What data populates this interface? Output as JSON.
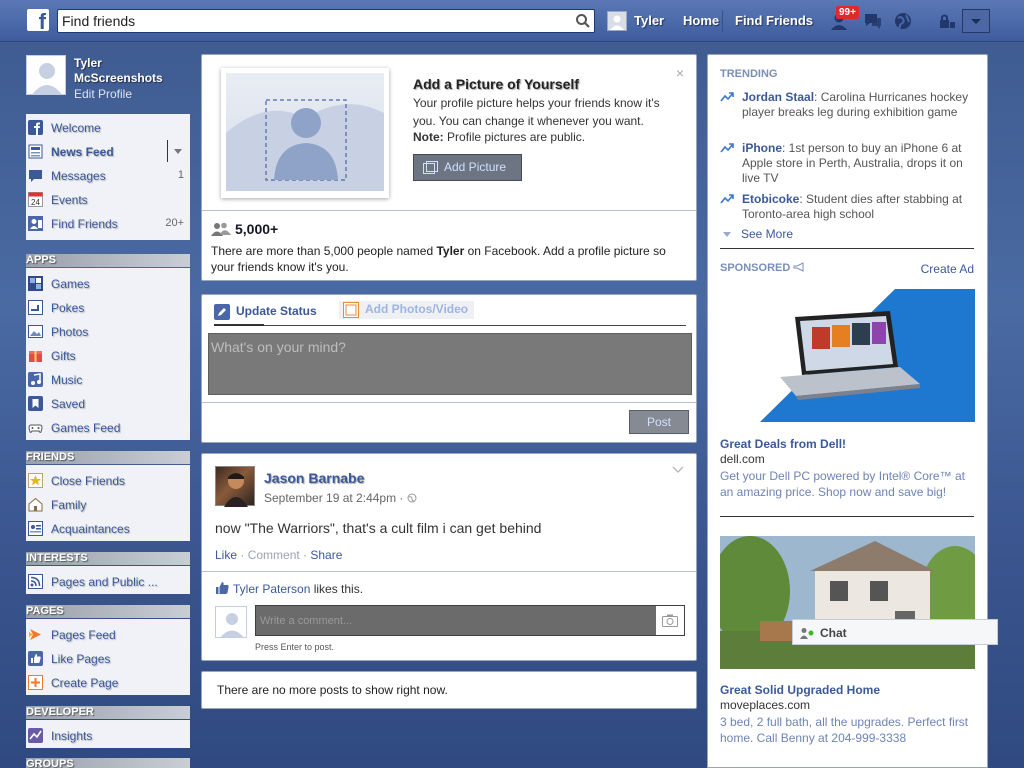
{
  "topbar": {
    "logo": "f",
    "search_placeholder": "Find friends",
    "user_name": "Tyler",
    "home_label": "Home",
    "find_friends_label": "Find Friends",
    "notification_badge": "99+"
  },
  "profile": {
    "name": "Tyler McScreenshots",
    "edit_label": "Edit Profile"
  },
  "nav_main": [
    {
      "label": "Welcome",
      "icon": "facebook-icon",
      "count": ""
    },
    {
      "label": "News Feed",
      "icon": "news-feed-icon",
      "count": ""
    },
    {
      "label": "Messages",
      "icon": "messages-icon",
      "count": "1"
    },
    {
      "label": "Events",
      "icon": "events-calendar-icon",
      "count": ""
    },
    {
      "label": "Find Friends",
      "icon": "find-friends-icon",
      "count": "20+"
    }
  ],
  "events_icon_number": "24",
  "sections": {
    "apps": "APPS",
    "friends": "FRIENDS",
    "interests": "INTERESTS",
    "pages": "PAGES",
    "developer": "DEVELOPER",
    "groups": "GROUPS"
  },
  "nav_apps": [
    {
      "label": "Games",
      "icon": "games-icon"
    },
    {
      "label": "Pokes",
      "icon": "pokes-icon"
    },
    {
      "label": "Photos",
      "icon": "photos-icon"
    },
    {
      "label": "Gifts",
      "icon": "gifts-icon"
    },
    {
      "label": "Music",
      "icon": "music-icon"
    },
    {
      "label": "Saved",
      "icon": "saved-icon"
    },
    {
      "label": "Games Feed",
      "icon": "games-feed-icon"
    }
  ],
  "nav_friends": [
    {
      "label": "Close Friends",
      "icon": "close-friends-icon"
    },
    {
      "label": "Family",
      "icon": "family-icon"
    },
    {
      "label": "Acquaintances",
      "icon": "acquaintances-icon"
    }
  ],
  "nav_interests": [
    {
      "label": "Pages and Public ...",
      "icon": "pages-public-icon"
    }
  ],
  "nav_pages": [
    {
      "label": "Pages Feed",
      "icon": "pages-feed-icon"
    },
    {
      "label": "Like Pages",
      "icon": "like-pages-icon"
    },
    {
      "label": "Create Page",
      "icon": "create-page-icon"
    }
  ],
  "nav_developer": [
    {
      "label": "Insights",
      "icon": "insights-icon"
    }
  ],
  "picture_card": {
    "title": "Add a Picture of Yourself",
    "body": "Your profile picture helps your friends know it's you. You can change it whenever you want.",
    "note_label": "Note:",
    "note_text": "Profile pictures are public.",
    "button": "Add Picture",
    "close": "×",
    "people_count": "5,000+",
    "people_text_1": "There are more than 5,000 people named ",
    "people_name": "Tyler",
    "people_text_2": " on Facebook. Add a profile picture so your friends know it's you."
  },
  "composer": {
    "tab_update": "Update Status",
    "tab_photos": "Add Photos/Video",
    "placeholder": "What's on your mind?",
    "post_button": "Post"
  },
  "feed_post": {
    "author": "Jason Barnabe",
    "date": "September 19 at 2:44pm ·",
    "text": "now \"The Warriors\", that's a cult film i can get behind",
    "action_like": "Like",
    "action_comment": "Comment",
    "action_share": "Share",
    "dot": " · ",
    "liker": "Tyler Paterson",
    "likes_suffix": " likes this.",
    "comment_placeholder": "Write a comment...",
    "press_enter": "Press Enter to post."
  },
  "no_more": "There are no more posts to show right now.",
  "trending": {
    "header": "TRENDING",
    "items": [
      {
        "name": "Jordan Staal",
        "text": ": Carolina Hurricanes hockey player breaks leg during exhibition game"
      },
      {
        "name": "iPhone",
        "text": ": 1st person to buy an iPhone 6 at Apple store in Perth, Australia, drops it on live TV"
      },
      {
        "name": "Etobicoke",
        "text": ": Student dies after stabbing at Toronto-area high school"
      }
    ],
    "see_more": "See More"
  },
  "sponsored": {
    "header": "SPONSORED",
    "create_ad": "Create Ad",
    "ads": [
      {
        "title": "Great Deals from Dell!",
        "domain": "dell.com",
        "body": "Get your Dell PC powered by Intel® Core™ at an amazing price. Shop now and save big!"
      },
      {
        "title": "Great Solid Upgraded Home",
        "domain": "moveplaces.com",
        "body": "3 bed, 2 full bath, all the upgrades. Perfect first home. Call Benny at 204-999-3338"
      }
    ]
  },
  "chat": {
    "label": "Chat"
  },
  "colors": {
    "brand_blue": "#3b5998",
    "topbar": "#4a67a7",
    "badge_red": "#e02a2a",
    "online_green": "#42b72a"
  }
}
